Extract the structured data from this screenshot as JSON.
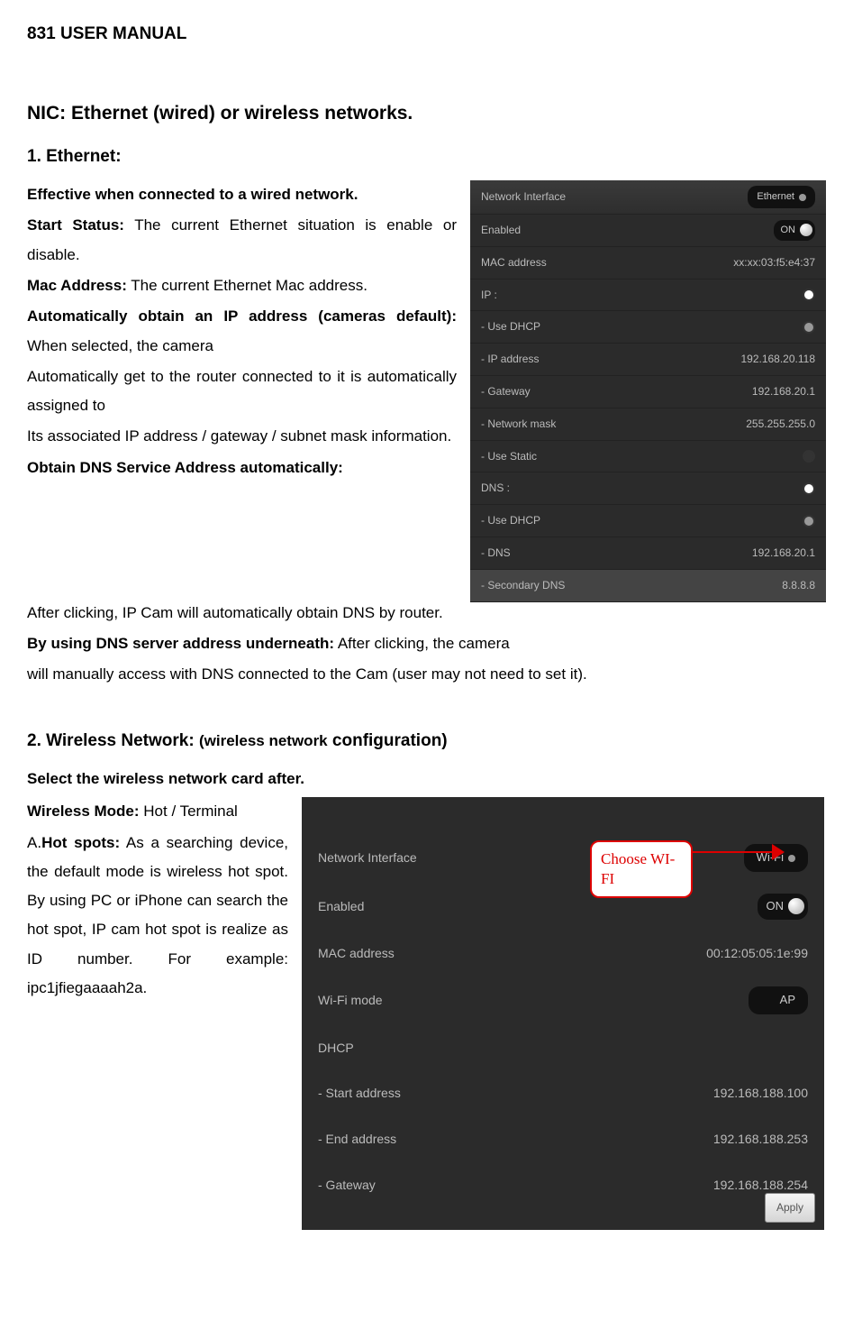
{
  "header": "831 USER MANUAL",
  "section1": {
    "title": "NIC: Ethernet (wired) or wireless networks.",
    "sub": "1. Ethernet:",
    "p1": "Effective when connected to a wired network.",
    "p2a": "Start Status:",
    "p2b": " The current Ethernet situation is enable or disable.",
    "p3a": "Mac Address:",
    "p3b": " The current Ethernet Mac address.",
    "p4a": "Automatically obtain an IP address (cameras default):",
    "p4b": " When selected, the camera",
    "p5": "Automatically get to the router connected to it is automatically assigned to",
    "p6": "Its associated IP address / gateway / subnet mask information.",
    "p7a": "Obtain DNS Service Address automatically:",
    "p7b": " After clicking, IP Cam will automatically obtain DNS by router.",
    "p8a": "By using DNS server address underneath:",
    "p8b": " After clicking, the camera",
    "p9": "will manually access with DNS connected to the Cam (user may not need to set it)."
  },
  "panel1": {
    "rows": {
      "r0l": "Network Interface",
      "r0r": "Ethernet",
      "r1l": "Enabled",
      "r1r": "ON",
      "r2l": "MAC address",
      "r2r": "xx:xx:03:f5:e4:37",
      "r3l": "IP :",
      "r4l": "- Use DHCP",
      "r5l": "- IP address",
      "r5r": "192.168.20.118",
      "r6l": "- Gateway",
      "r6r": "192.168.20.1",
      "r7l": "- Network mask",
      "r7r": "255.255.255.0",
      "r8l": "- Use Static",
      "r9l": "DNS :",
      "r10l": "- Use DHCP",
      "r11l": "- DNS",
      "r11r": "192.168.20.1",
      "r12l": "- Secondary DNS",
      "r12r": "8.8.8.8"
    }
  },
  "section2": {
    "title_a": "2. Wireless Network: ",
    "title_b": "(wireless network",
    "title_c": " configuration)",
    "p1": "Select the wireless network card after.",
    "p2a": "Wireless Mode:",
    "p2b": " Hot / Terminal",
    "p3a": "A.",
    "p3b": "Hot spots:",
    "p3c": " As a searching device, the default mode is wireless hot spot. By using PC or iPhone can search the hot spot, IP cam hot spot is realize as ID number. For example: ipc1jfiegaaaah2a."
  },
  "panel2": {
    "callout": "Choose WI-FI",
    "rows": {
      "r0l": "Network Interface",
      "r0r": "Wi-Fi",
      "r1l": "Enabled",
      "r1r": "ON",
      "r2l": "MAC address",
      "r2r": "00:12:05:05:1e:99",
      "r3l": "Wi-Fi mode",
      "r3r": "AP",
      "r4l": "DHCP",
      "r5l": "- Start address",
      "r5r": "192.168.188.100",
      "r6l": "- End address",
      "r6r": "192.168.188.253",
      "r7l": "- Gateway",
      "r7r": "192.168.188.254"
    },
    "apply": "Apply"
  }
}
